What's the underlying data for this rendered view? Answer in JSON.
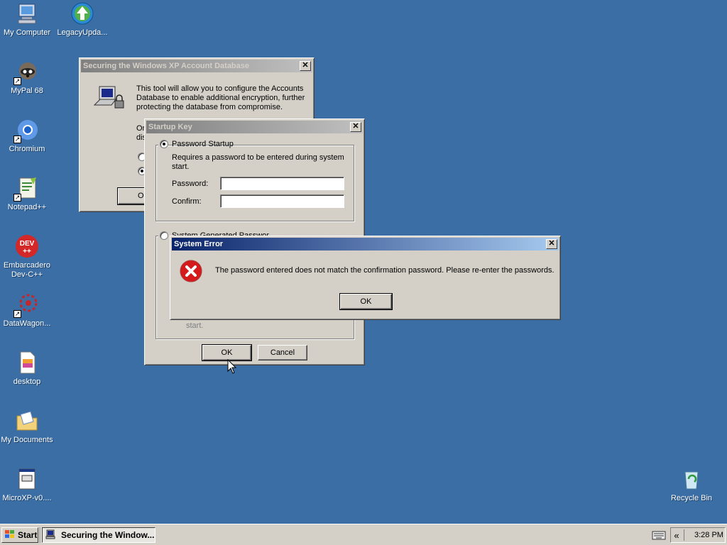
{
  "desktop": {
    "icons": [
      {
        "label": "My Computer"
      },
      {
        "label": "LegacyUpda..."
      },
      {
        "label": "MyPal 68"
      },
      {
        "label": "Chromium"
      },
      {
        "label": "Notepad++"
      },
      {
        "label": "Embarcadero Dev-C++"
      },
      {
        "label": "DataWagon..."
      },
      {
        "label": "desktop"
      },
      {
        "label": "My Documents"
      },
      {
        "label": "MicroXP-v0...."
      },
      {
        "label": "Recycle Bin"
      }
    ]
  },
  "account_db_window": {
    "title": "Securing the Windows XP Account Database",
    "description": "This tool will allow you to configure the Accounts Database to enable additional encryption, further protecting the database from compromise.",
    "partial_text_1": "Or",
    "partial_text_2": "dis",
    "ok_partial": "Ol"
  },
  "startup_key_window": {
    "title": "Startup Key",
    "password_startup_label": "Password Startup",
    "password_startup_desc": "Requires a password to be entered during system start.",
    "password_label": "Password:",
    "password_value": "",
    "confirm_label": "Confirm:",
    "confirm_value": "",
    "system_generated_partial": "System Generated Password",
    "trailing_text": "start.",
    "ok_label": "OK",
    "cancel_label": "Cancel",
    "password_startup_selected": true
  },
  "error_dialog": {
    "title": "System Error",
    "message": "The password entered does not match the confirmation password.  Please re-enter the passwords.",
    "ok_label": "OK",
    "icon": "error-icon"
  },
  "taskbar": {
    "start_label": "Start",
    "task_label": "Securing the Window...",
    "tray_chevron": "«",
    "clock": "3:28 PM"
  }
}
